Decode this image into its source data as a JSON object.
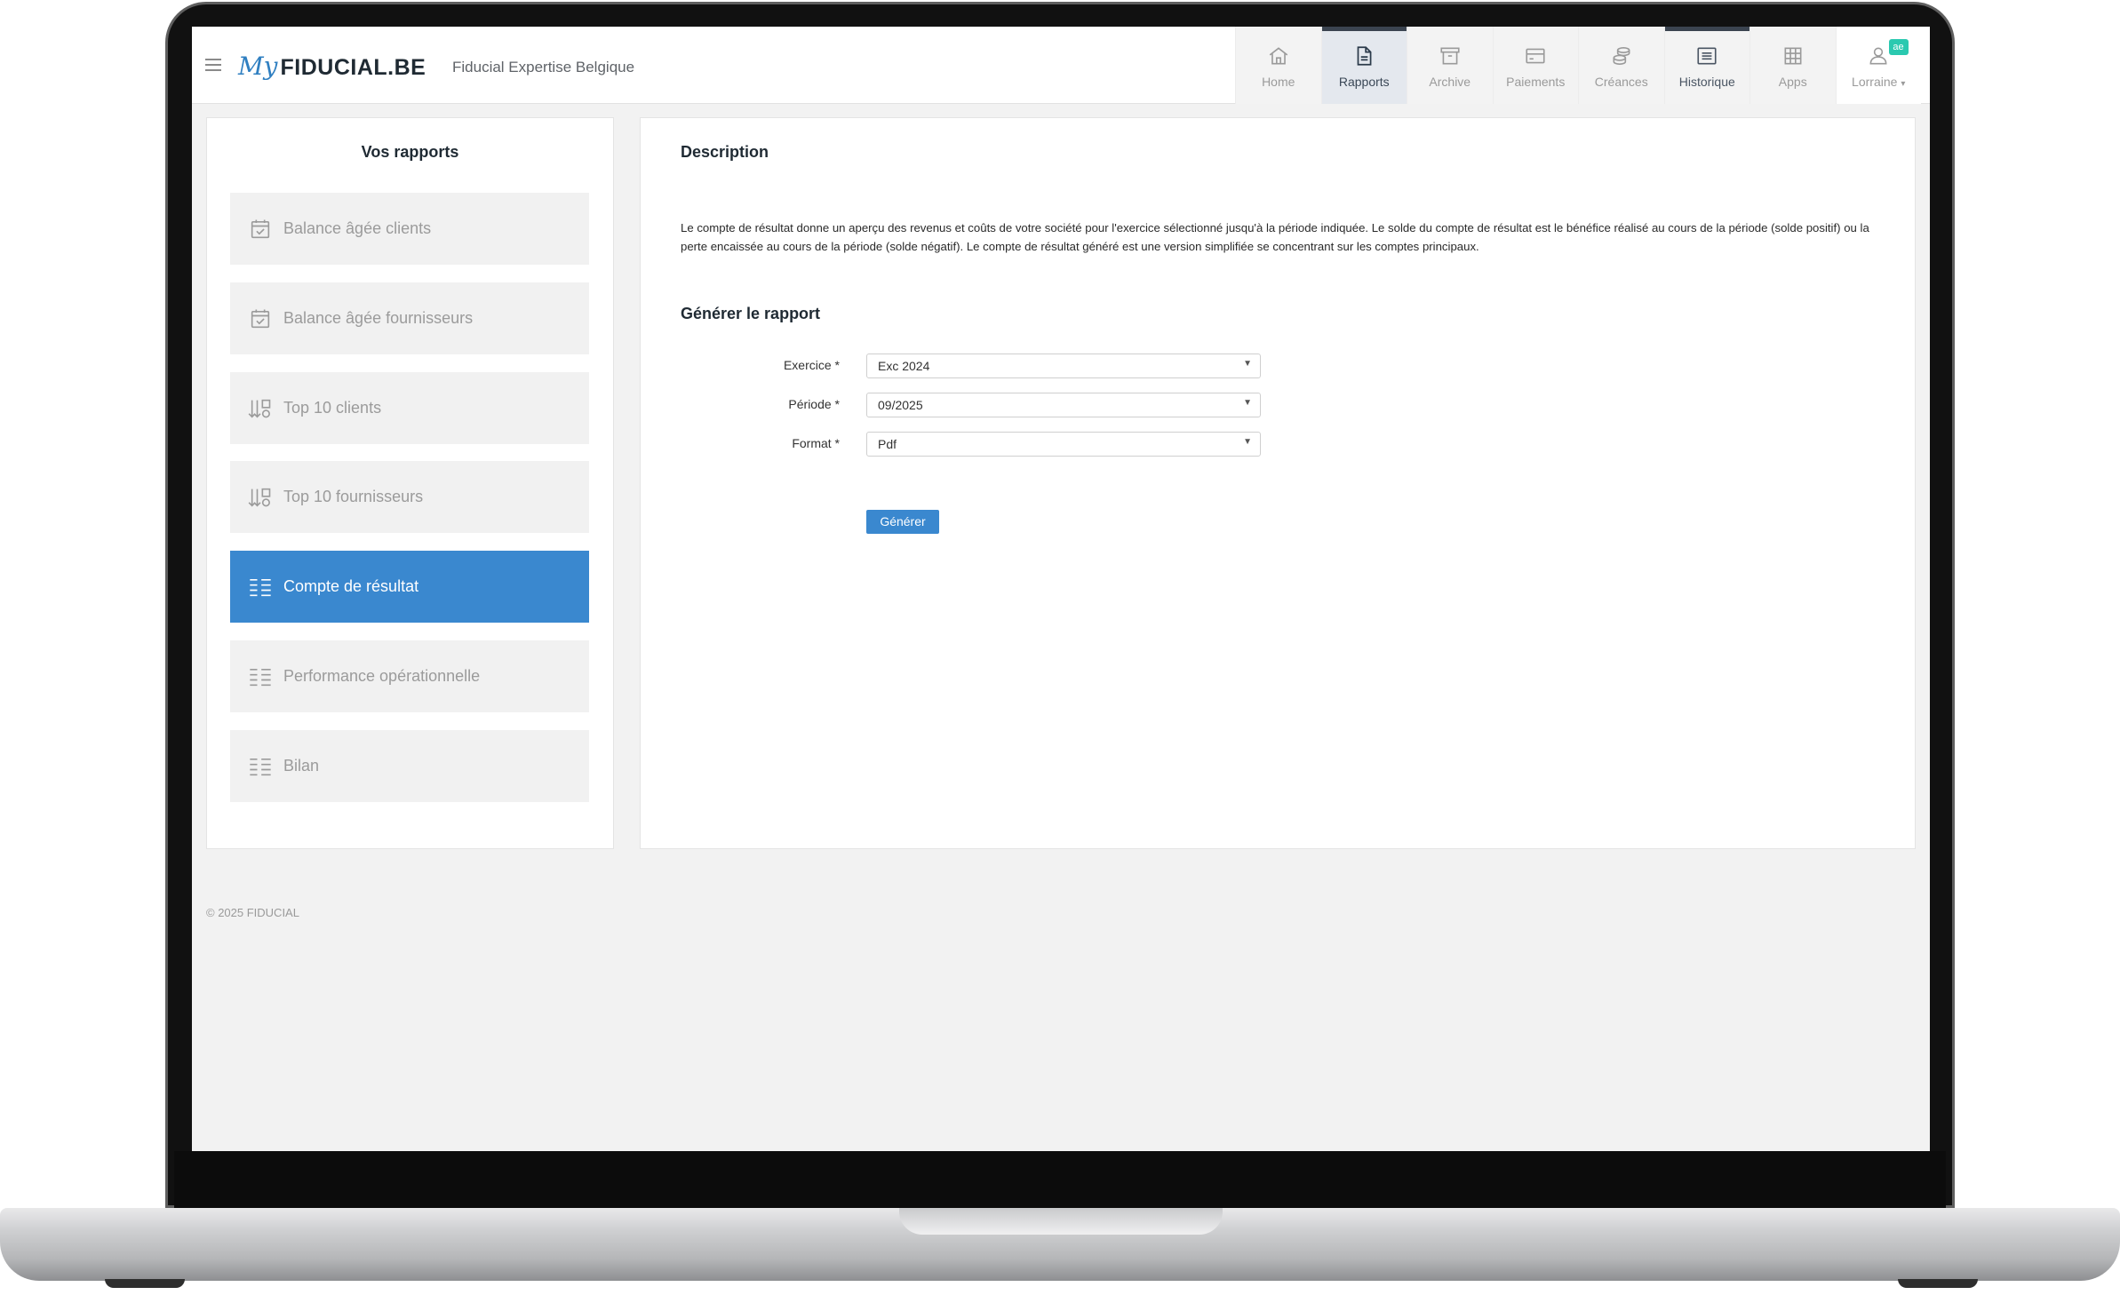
{
  "header": {
    "logo_my": "My",
    "logo_name": "FIDUCIAL.BE",
    "company": "Fiducial Expertise Belgique"
  },
  "nav": {
    "items": [
      {
        "label": "Home",
        "icon": "home-icon"
      },
      {
        "label": "Rapports",
        "icon": "document-icon"
      },
      {
        "label": "Archive",
        "icon": "archive-icon"
      },
      {
        "label": "Paiements",
        "icon": "credit-card-icon"
      },
      {
        "label": "Créances",
        "icon": "coins-icon"
      },
      {
        "label": "Historique",
        "icon": "list-icon"
      },
      {
        "label": "Apps",
        "icon": "grid-icon"
      },
      {
        "label": "Lorraine",
        "icon": "user-icon",
        "badge": "ae"
      }
    ]
  },
  "sidebar": {
    "title": "Vos rapports",
    "items": [
      {
        "label": "Balance âgée clients",
        "icon": "calendar-check-icon"
      },
      {
        "label": "Balance âgée fournisseurs",
        "icon": "calendar-check-icon"
      },
      {
        "label": "Top 10 clients",
        "icon": "sort-down-icon"
      },
      {
        "label": "Top 10 fournisseurs",
        "icon": "sort-down-icon"
      },
      {
        "label": "Compte de résultat",
        "icon": "list-lines-icon",
        "active": true
      },
      {
        "label": "Performance opérationnelle",
        "icon": "list-lines-icon"
      },
      {
        "label": "Bilan",
        "icon": "list-lines-icon"
      }
    ]
  },
  "main": {
    "description_title": "Description",
    "description_text": "Le compte de résultat donne un aperçu des revenus et coûts de votre société pour l'exercice sélectionné jusqu'à la période indiquée. Le solde du compte de résultat est le bénéfice réalisé au cours de la période (solde positif) ou la perte encaissée au cours de la période (solde négatif). Le compte de résultat généré est une version simplifiée se concentrant sur les comptes principaux.",
    "generate_title": "Générer le rapport",
    "form": {
      "exercice_label": "Exercice *",
      "exercice_value": "Exc 2024",
      "periode_label": "Période *",
      "periode_value": "09/2025",
      "format_label": "Format *",
      "format_value": "Pdf"
    },
    "generate_button": "Générer"
  },
  "footer": "© 2025 FIDUCIAL",
  "colors": {
    "accent": "#3a88cf",
    "badge": "#2ac9b0"
  }
}
